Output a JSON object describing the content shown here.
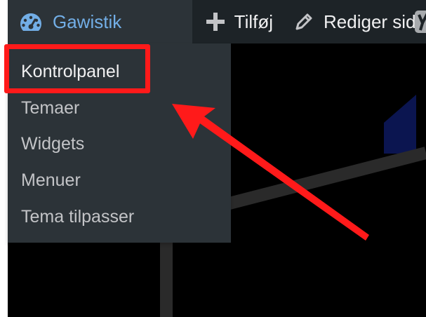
{
  "admin_bar": {
    "site_name": "Gawistik",
    "new_label": "Tilføj",
    "edit_label": "Rediger side",
    "site_icon": "dashboard-gauge-icon",
    "new_icon": "plus-icon",
    "edit_icon": "pencil-icon",
    "seo_icon": "yoast-icon"
  },
  "dropdown": {
    "items": [
      {
        "label": "Kontrolpanel"
      },
      {
        "label": "Temaer"
      },
      {
        "label": "Widgets"
      },
      {
        "label": "Menuer"
      },
      {
        "label": "Tema tilpasser"
      }
    ]
  },
  "colors": {
    "admin_bar_bg": "#1d2327",
    "dropdown_bg": "#2c3338",
    "site_name_color": "#72aee6",
    "annotation_red": "#ff1a1a"
  }
}
